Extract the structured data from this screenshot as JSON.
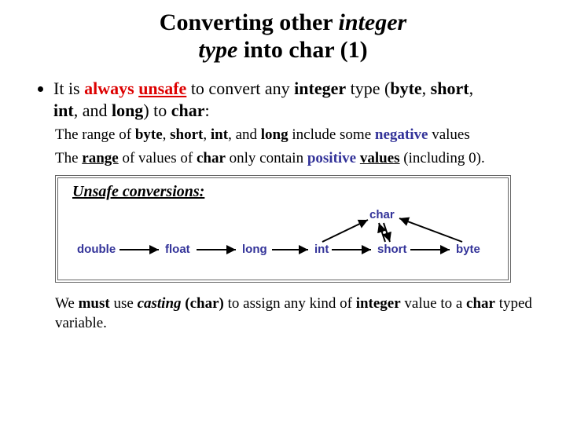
{
  "title_line1_a": "Converting other ",
  "title_line1_b": "integer",
  "title_line2_a": "type",
  "title_line2_b": " into char (1)",
  "bullet1_a": "It is ",
  "bullet1_b": "always",
  "bullet1_c": " ",
  "bullet1_d": "unsafe",
  "bullet1_e": " to convert any ",
  "bullet1_f": "integer",
  "bullet1_g": " type (",
  "bullet1_h": "byte",
  "bullet1_i": ", ",
  "bullet1_j": "short",
  "bullet1_k": ", ",
  "bullet1_l": "int",
  "bullet1_m": ", and ",
  "bullet1_n": "long",
  "bullet1_o": ") to ",
  "bullet1_p": "char",
  "bullet1_q": ":",
  "sub1_a": "The range of ",
  "sub1_b": "byte",
  "sub1_c": ", ",
  "sub1_d": "short",
  "sub1_e": ", ",
  "sub1_f": "int",
  "sub1_g": ", and ",
  "sub1_h": "long",
  "sub1_i": " include some ",
  "sub1_j": "negative",
  "sub1_k": " values",
  "sub2_a": "The ",
  "sub2_b": "range",
  "sub2_c": " of values of ",
  "sub2_d": "char",
  "sub2_e": " only contain ",
  "sub2_f": "positive",
  "sub2_g": " ",
  "sub2_h": "values",
  "sub2_i": " (including 0).",
  "diag_title": "Unsafe conversions:",
  "types": {
    "double": "double",
    "float": "float",
    "long": "long",
    "int": "int",
    "short": "short",
    "byte": "byte",
    "char": "char"
  },
  "note_a": "We ",
  "note_b": "must",
  "note_c": " use ",
  "note_d": "casting",
  "note_e": " ",
  "note_f": "(char)",
  "note_g": " to assign any kind of ",
  "note_h": "integer",
  "note_i": " value to a ",
  "note_j": "char",
  "note_k": " typed variable."
}
